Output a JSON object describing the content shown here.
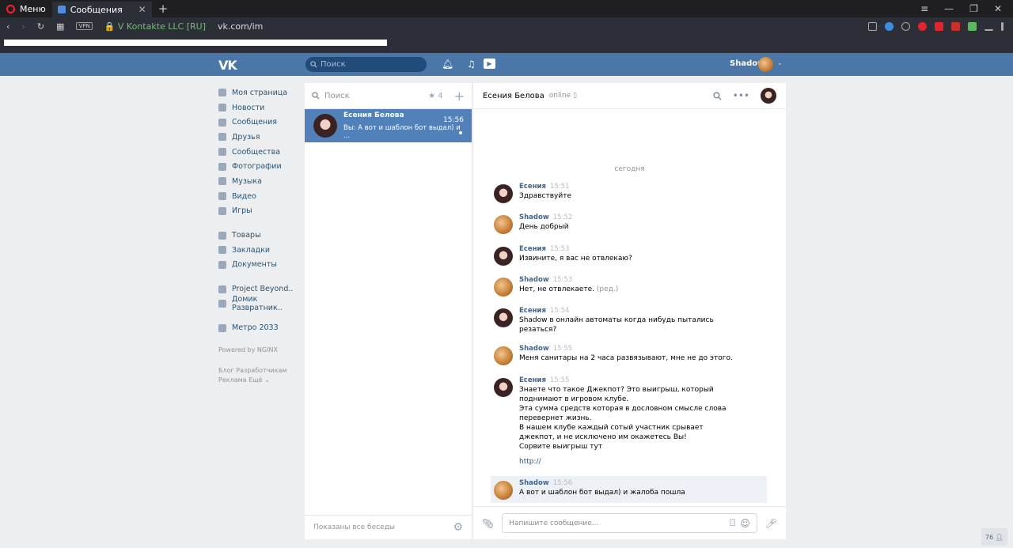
{
  "browser": {
    "menu_label": "Меню",
    "tab_title": "Сообщения",
    "tab_close": "✕",
    "new_tab": "+",
    "vpn": "VPN",
    "security": "V Kontakte LLC [RU]",
    "url": "vk.com/im"
  },
  "header": {
    "logo": "VK",
    "search_placeholder": "Поиск",
    "user_name": "Shadow"
  },
  "nav": {
    "main": [
      "Моя страница",
      "Новости",
      "Сообщения",
      "Друзья",
      "Сообщества",
      "Фотографии",
      "Музыка",
      "Видео",
      "Игры"
    ],
    "secondary": [
      "Товары",
      "Закладки",
      "Документы"
    ],
    "groups": [
      "Project Beyond..",
      "Домик Разврaтник.."
    ],
    "apps": [
      "Метро 2033"
    ],
    "powered": "Powered by NGINX",
    "footer_line1": "Блог   Разработчикам",
    "footer_line2": "Реклама   Ещё ⌄"
  },
  "conversations": {
    "search_placeholder": "Поиск",
    "favorites_count": "4",
    "items": [
      {
        "name": "Есения Белова",
        "time": "15:56",
        "preview": "Вы: А вот и шаблон бот выдал) и ..."
      }
    ],
    "footer": "Показаны все беседы"
  },
  "chat": {
    "title": "Есения Белова",
    "status": "online",
    "day": "сегодня",
    "messages": [
      {
        "author": "Есения",
        "time": "15:51",
        "text": "Здравствуйте"
      },
      {
        "author": "Shadow",
        "time": "15:52",
        "text": "День добрый"
      },
      {
        "author": "Есения",
        "time": "15:53",
        "text": "Извините, я вас не отвлекаю?"
      },
      {
        "author": "Shadow",
        "time": "15:53",
        "text": "Нет, не отвлекаете.",
        "edited": "(ред.)"
      },
      {
        "author": "Есения",
        "time": "15:54",
        "text": "Shadow в онлайн автоматы когда нибудь пытались резаться?"
      },
      {
        "author": "Shadow",
        "time": "15:55",
        "text": "Меня санитары на 2 часа развязывают, мне не до этого."
      },
      {
        "author": "Есения",
        "time": "15:55",
        "text": "Знаете что такое Джекпот? Это выигрыш, который поднимают в игровом клубе.\nЭта сумма средств которая в дословном смысле слова перевернет жизнь.\nВ нашем клубе каждый сотый участник срывает джекпот, и не исключено им окажетесь Вы!\nСорвите выигрыш тут",
        "link": "http://"
      },
      {
        "author": "Shadow",
        "time": "15:56",
        "text": "А вот и шаблон бот выдал) и жалоба пошла"
      }
    ],
    "composer_placeholder": "Напишите сообщение..."
  },
  "online_count": "76"
}
